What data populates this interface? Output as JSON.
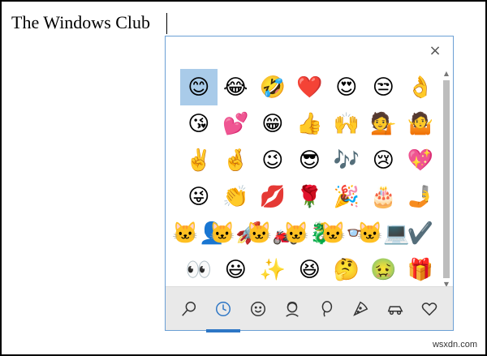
{
  "document": {
    "text": "The Windows Club"
  },
  "emoji_panel": {
    "close_label": "×",
    "emojis": [
      "😊",
      "😂",
      "🤣",
      "❤️",
      "😍",
      "😒",
      "👌",
      "😘",
      "💕",
      "😁",
      "👍",
      "🙌",
      "💁",
      "🤷",
      "✌️",
      "🤞",
      "😉",
      "😎",
      "🎶",
      "😢",
      "💖",
      "😜",
      "👏",
      "💋",
      "🌹",
      "🎉",
      "🎂",
      "🤳",
      "🐱‍👤",
      "🐱‍🚀",
      "🐱‍🏍",
      "🐱‍🐉",
      "🐱‍👓",
      "🐱‍💻",
      "✔️",
      "👀",
      "😃",
      "✨",
      "😆",
      "🤔",
      "🤢",
      "🎁"
    ],
    "selected_index": 0,
    "tabs": [
      {
        "name": "search",
        "icon": "search-icon"
      },
      {
        "name": "recent",
        "icon": "clock-icon",
        "active": true
      },
      {
        "name": "smiley",
        "icon": "smiley-icon"
      },
      {
        "name": "people",
        "icon": "person-icon"
      },
      {
        "name": "celebration",
        "icon": "balloon-icon"
      },
      {
        "name": "food",
        "icon": "pizza-icon"
      },
      {
        "name": "travel",
        "icon": "car-icon"
      },
      {
        "name": "symbols",
        "icon": "heart-icon"
      }
    ]
  },
  "watermark": "wsxdn.com"
}
